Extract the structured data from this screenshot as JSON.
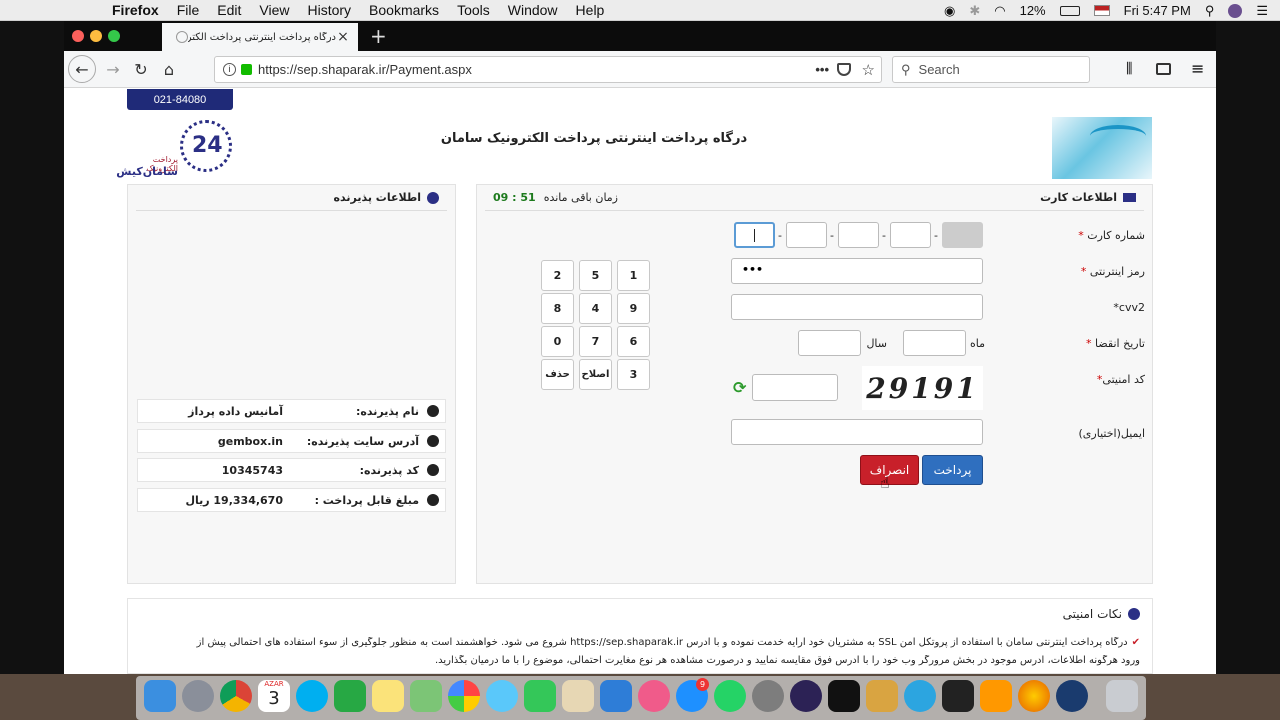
{
  "menubar": {
    "items": [
      "Firefox",
      "File",
      "Edit",
      "View",
      "History",
      "Bookmarks",
      "Tools",
      "Window",
      "Help"
    ],
    "battery": "12%",
    "clock": "Fri 5:47 PM"
  },
  "browser": {
    "tab_title": "درگاه پرداخت اینترنتی پرداخت الکترونیک س",
    "url": "https://sep.shaparak.ir/Payment.aspx",
    "search_placeholder": "Search"
  },
  "page": {
    "phone": "021-84080",
    "header_title": "درگاه پرداخت اینترنتی پرداخت الکترونیک سامان",
    "logo_text": "سامان‌کیش",
    "logo_subtitle": "پرداخت الکترونیک",
    "logo_number": "24",
    "card_panel": {
      "title": "اطلاعات کارت",
      "timer_label": "زمان باقی مانده",
      "timer_value": "09 : 51",
      "card_label": "شماره کارت",
      "pin_label": "رمز اینترنتی",
      "pin_value": "•••",
      "cvv_label": "cvv2*",
      "expiry_label": "تاریخ انقضا",
      "month_label": "ماه",
      "year_label": "سال",
      "captcha_label": "کد امنیتی",
      "captcha_text": "29191",
      "email_label": "ایمیل(اختیاری)",
      "pay_button": "پرداخت",
      "cancel_button": "انصراف",
      "keypad": [
        "1",
        "5",
        "2",
        "9",
        "4",
        "8",
        "6",
        "7",
        "0",
        "3",
        "اصلاح",
        "حذف"
      ]
    },
    "merchant_panel": {
      "title": "اطلاعات پذیرنده",
      "rows": [
        {
          "key": "نام پذیرنده:",
          "value": "آمانیس داده پرداز"
        },
        {
          "key": "آدرس سایت پذیرنده:",
          "value": "gembox.in"
        },
        {
          "key": "کد پذیرنده:",
          "value": "10345743"
        },
        {
          "key": "مبلغ قابل پرداخت :",
          "value": "19,334,670 ریال"
        }
      ]
    },
    "security": {
      "title": "نکات امنیتی",
      "text1": "درگاه پرداخت اینترنتی سامان با استفاده از پروتکل امن SSL به مشتریان خود ارایه خدمت نموده و با آدرس https://sep.shaparak.ir شروع می شود. خواهشمند است به منظور جلوگیری از سوء استفاده های احتمالی پیش از",
      "text2": "ورود هرگونه اطلاعات، آدرس موجود در بخش مرورگر وب خود را با آدرس فوق مقایسه نمایید و درصورت مشاهده هر نوع مغایرت احتمالی، موضوع را با ما درمیان بگذارید."
    }
  },
  "dock": {
    "calendar_day": "3",
    "calendar_month": "AZAR",
    "appstore_badge": "9"
  }
}
